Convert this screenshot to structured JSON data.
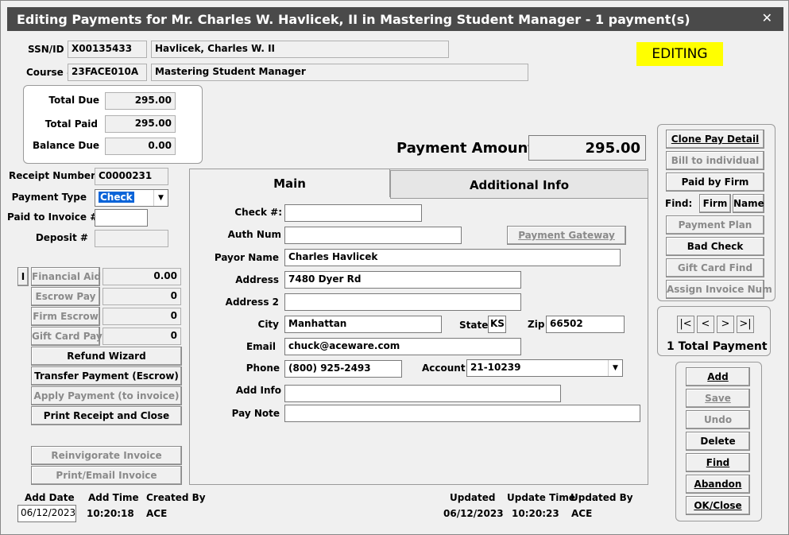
{
  "window": {
    "title": "Editing Payments for Mr. Charles W. Havlicek, II  in Mastering Student Manager - 1 payment(s)",
    "close_glyph": "✕"
  },
  "status_badge": "EDITING",
  "header": {
    "ssn_label": "SSN/ID",
    "ssn_value": "X00135433",
    "name_value": "Havlicek, Charles W. II",
    "course_label": "Course #",
    "course_value": "23FACE010A",
    "course_name": "Mastering Student Manager"
  },
  "totals": {
    "total_due_label": "Total Due",
    "total_due": "295.00",
    "total_paid_label": "Total Paid",
    "total_paid": "295.00",
    "balance_due_label": "Balance Due",
    "balance_due": "0.00"
  },
  "payment_amount": {
    "label": "Payment Amount",
    "value": "295.00"
  },
  "left_form": {
    "receipt_label": "Receipt Number",
    "receipt_value": "C0000231",
    "payment_type_label": "Payment Type",
    "payment_type_value": "Check",
    "paid_invoice_label": "Paid to Invoice #",
    "paid_invoice_value": "",
    "deposit_label": "Deposit #",
    "deposit_value": ""
  },
  "aid_rows": {
    "i_button": "I",
    "financial_aid_label": "Financial Aid",
    "financial_aid_value": "0.00",
    "escrow_pay_label": "Escrow Pay",
    "escrow_pay_value": "0",
    "firm_escrow_label": "Firm Escrow",
    "firm_escrow_value": "0",
    "gift_card_label": "Gift Card Pay",
    "gift_card_value": "0"
  },
  "left_buttons": {
    "refund_wizard": "Refund Wizard",
    "transfer_payment": "Transfer Payment (Escrow)",
    "apply_payment": "Apply Payment (to invoice)",
    "print_receipt": "Print Receipt and Close",
    "reinvigorate": "Reinvigorate Invoice",
    "print_email": "Print/Email Invoice"
  },
  "tabs": {
    "main": "Main",
    "additional": "Additional Info"
  },
  "main_form": {
    "check_label": "Check #:",
    "check_value": "",
    "auth_label": "Auth Num",
    "auth_value": "",
    "gateway_button": "Payment Gateway",
    "payor_label": "Payor Name",
    "payor_value": "Charles Havlicek",
    "address_label": "Address",
    "address_value": "7480 Dyer Rd",
    "address2_label": "Address 2",
    "address2_value": "",
    "city_label": "City",
    "city_value": "Manhattan",
    "state_label": "State",
    "state_value": "KS",
    "zip_label": "Zip",
    "zip_value": "66502",
    "email_label": "Email",
    "email_value": "chuck@aceware.com",
    "phone_label": "Phone",
    "phone_value": "(800) 925-2493",
    "account_label": "Account",
    "account_value": "21-10239",
    "addinfo_label": "Add Info",
    "addinfo_value": "",
    "paynote_label": "Pay Note",
    "paynote_value": ""
  },
  "right_buttons": {
    "clone": "Clone Pay Detail",
    "bill_individual": "Bill to individual",
    "paid_by_firm": "Paid by Firm",
    "find_label": "Find:",
    "firm": "Firm",
    "name": "Name",
    "payment_plan": "Payment Plan",
    "bad_check": "Bad Check",
    "gift_card_find": "Gift Card Find",
    "assign_invoice": "Assign Invoice Num"
  },
  "navigator": {
    "first": "|<",
    "prev": "<",
    "next": ">",
    "last": ">|",
    "total": "1 Total Payment"
  },
  "action_buttons": {
    "add": "Add",
    "save": "Save",
    "undo": "Undo",
    "delete": "Delete",
    "find": "Find",
    "abandon": "Abandon",
    "ok_close": "OK/Close"
  },
  "footer": {
    "add_date_label": "Add Date",
    "add_date": "06/12/2023",
    "add_time_label": "Add Time",
    "add_time": "10:20:18",
    "created_by_label": "Created By",
    "created_by": "ACE",
    "updated_label": "Updated",
    "updated": "06/12/2023",
    "update_time_label": "Update Time",
    "update_time": "10:20:23",
    "updated_by_label": "Updated By",
    "updated_by": "ACE"
  },
  "colors": {
    "titlebar": "#4a4a4a",
    "editing_badge": "#ffff00",
    "window_bg": "#f0f0f0"
  }
}
